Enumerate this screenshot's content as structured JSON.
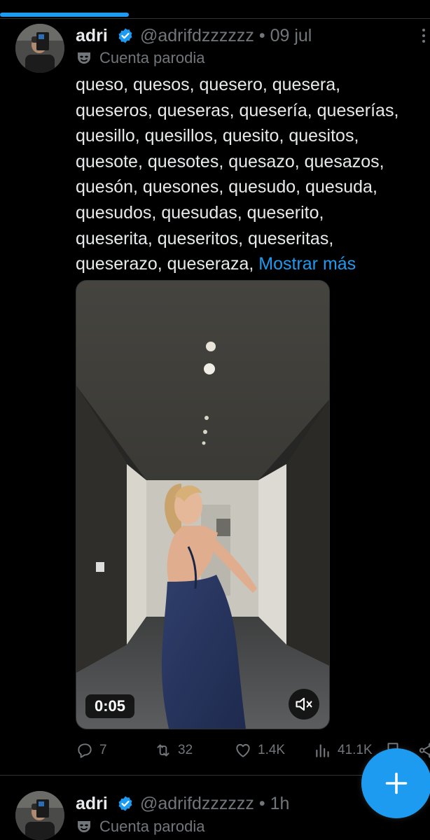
{
  "progress": {
    "fraction": 0.3
  },
  "tweets": [
    {
      "name": "adri",
      "handle": "@adrifdzzzzzz",
      "dot": "•",
      "time": "09 jul",
      "label": "Cuenta parodia",
      "text": "queso, quesos, quesero, quesera,\nqueseros, queseras, quesería, queserías,\nquesillo, quesillos, quesito, quesitos,\nquesote, quesotes, quesazo, quesazos,\nquesón, quesones, quesudo, quesuda,\nquesudos, quesudas, queserito,\nqueserita, queseritos, queseritas,\nqueserazo, queseraza, ",
      "show_more": "Mostrar más",
      "video_time": "0:05",
      "stats": {
        "replies": "7",
        "reposts": "32",
        "likes": "1.4K",
        "views": "41.1K"
      }
    },
    {
      "name": "adri",
      "handle": "@adrifdzzzzzz",
      "dot": "•",
      "time": "1h",
      "label": "Cuenta parodia"
    }
  ],
  "colors": {
    "accent": "#1d9bf0",
    "muted": "#71767b",
    "text": "#e7e9ea",
    "background": "#000000"
  },
  "icons": [
    "verified-badge-icon",
    "parody-mask-icon",
    "more-icon",
    "reply-icon",
    "repost-icon",
    "like-icon",
    "views-icon",
    "bookmark-icon",
    "share-icon",
    "muted-speaker-icon",
    "plus-icon"
  ]
}
